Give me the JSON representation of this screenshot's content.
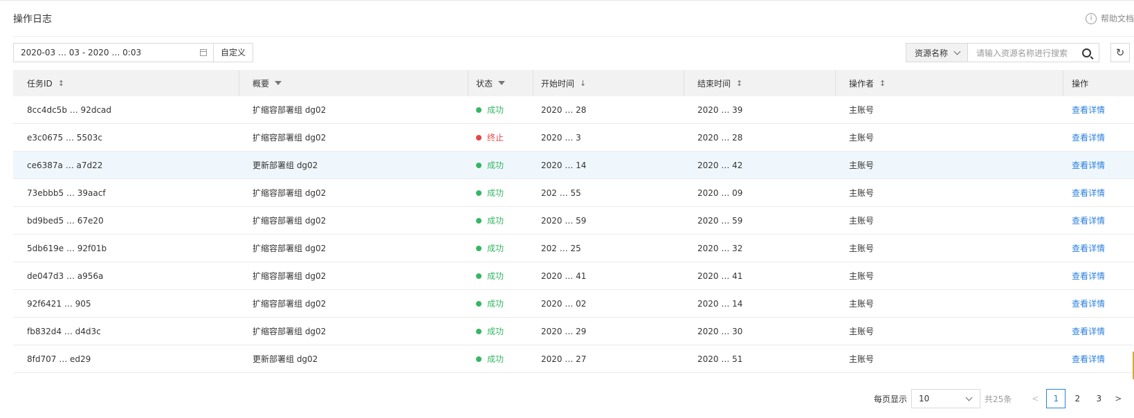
{
  "header": {
    "title": "操作日志",
    "help_label": "帮助文档"
  },
  "filter": {
    "date_range": "2020-03 … 03 - 2020 … 0:03",
    "custom_label": "自定义"
  },
  "search": {
    "select_label": "资源名称",
    "placeholder": "请输入资源名称进行搜索"
  },
  "table": {
    "columns": [
      "任务ID",
      "概要",
      "状态",
      "开始时间",
      "结束时间",
      "操作者",
      "操作"
    ],
    "rows": [
      {
        "id": "8cc4dc5b … 92dcad",
        "summary": "扩缩容部署组 dg02",
        "status": "成功",
        "status_type": "ok",
        "start": "2020 … 28",
        "end": "2020 … 39",
        "operator": "主账号",
        "action": "查看详情"
      },
      {
        "id": "e3c0675 … 5503c",
        "summary": "扩缩容部署组 dg02",
        "status": "终止",
        "status_type": "stop",
        "start": "2020 … 3",
        "end": "2020 … 28",
        "operator": "主账号",
        "action": "查看详情"
      },
      {
        "id": "ce6387a … a7d22",
        "summary": "更新部署组 dg02",
        "status": "成功",
        "status_type": "ok",
        "start": "2020 … 14",
        "end": "2020 … 42",
        "operator": "主账号",
        "action": "查看详情"
      },
      {
        "id": "73ebbb5 … 39aacf",
        "summary": "扩缩容部署组 dg02",
        "status": "成功",
        "status_type": "ok",
        "start": "202 … 55",
        "end": "2020 … 09",
        "operator": "主账号",
        "action": "查看详情"
      },
      {
        "id": "bd9bed5 … 67e20",
        "summary": "扩缩容部署组 dg02",
        "status": "成功",
        "status_type": "ok",
        "start": "2020 … 59",
        "end": "2020 … 59",
        "operator": "主账号",
        "action": "查看详情"
      },
      {
        "id": "5db619e … 92f01b",
        "summary": "扩缩容部署组 dg02",
        "status": "成功",
        "status_type": "ok",
        "start": "202 … 25",
        "end": "2020 … 32",
        "operator": "主账号",
        "action": "查看详情"
      },
      {
        "id": "de047d3 … a956a",
        "summary": "扩缩容部署组 dg02",
        "status": "成功",
        "status_type": "ok",
        "start": "2020 … 41",
        "end": "2020 … 41",
        "operator": "主账号",
        "action": "查看详情"
      },
      {
        "id": "92f6421 … 905",
        "summary": "扩缩容部署组 dg02",
        "status": "成功",
        "status_type": "ok",
        "start": "2020 … 02",
        "end": "2020 … 14",
        "operator": "主账号",
        "action": "查看详情"
      },
      {
        "id": "fb832d4 … d4d3c",
        "summary": "扩缩容部署组 dg02",
        "status": "成功",
        "status_type": "ok",
        "start": "2020 … 29",
        "end": "2020 … 30",
        "operator": "主账号",
        "action": "查看详情"
      },
      {
        "id": "8fd707 … ed29",
        "summary": "更新部署组 dg02",
        "status": "成功",
        "status_type": "ok",
        "start": "2020 … 27",
        "end": "2020 … 51",
        "operator": "主账号",
        "action": "查看详情"
      }
    ]
  },
  "pagination": {
    "per_page_label": "每页显示",
    "per_page_value": "10",
    "total": "共25条",
    "prev": "<",
    "next": ">",
    "pages": [
      "1",
      "2",
      "3"
    ],
    "current": "1"
  },
  "colors": {
    "accent": "#2a7fde",
    "success": "#34b764",
    "stopped": "#e54545"
  }
}
